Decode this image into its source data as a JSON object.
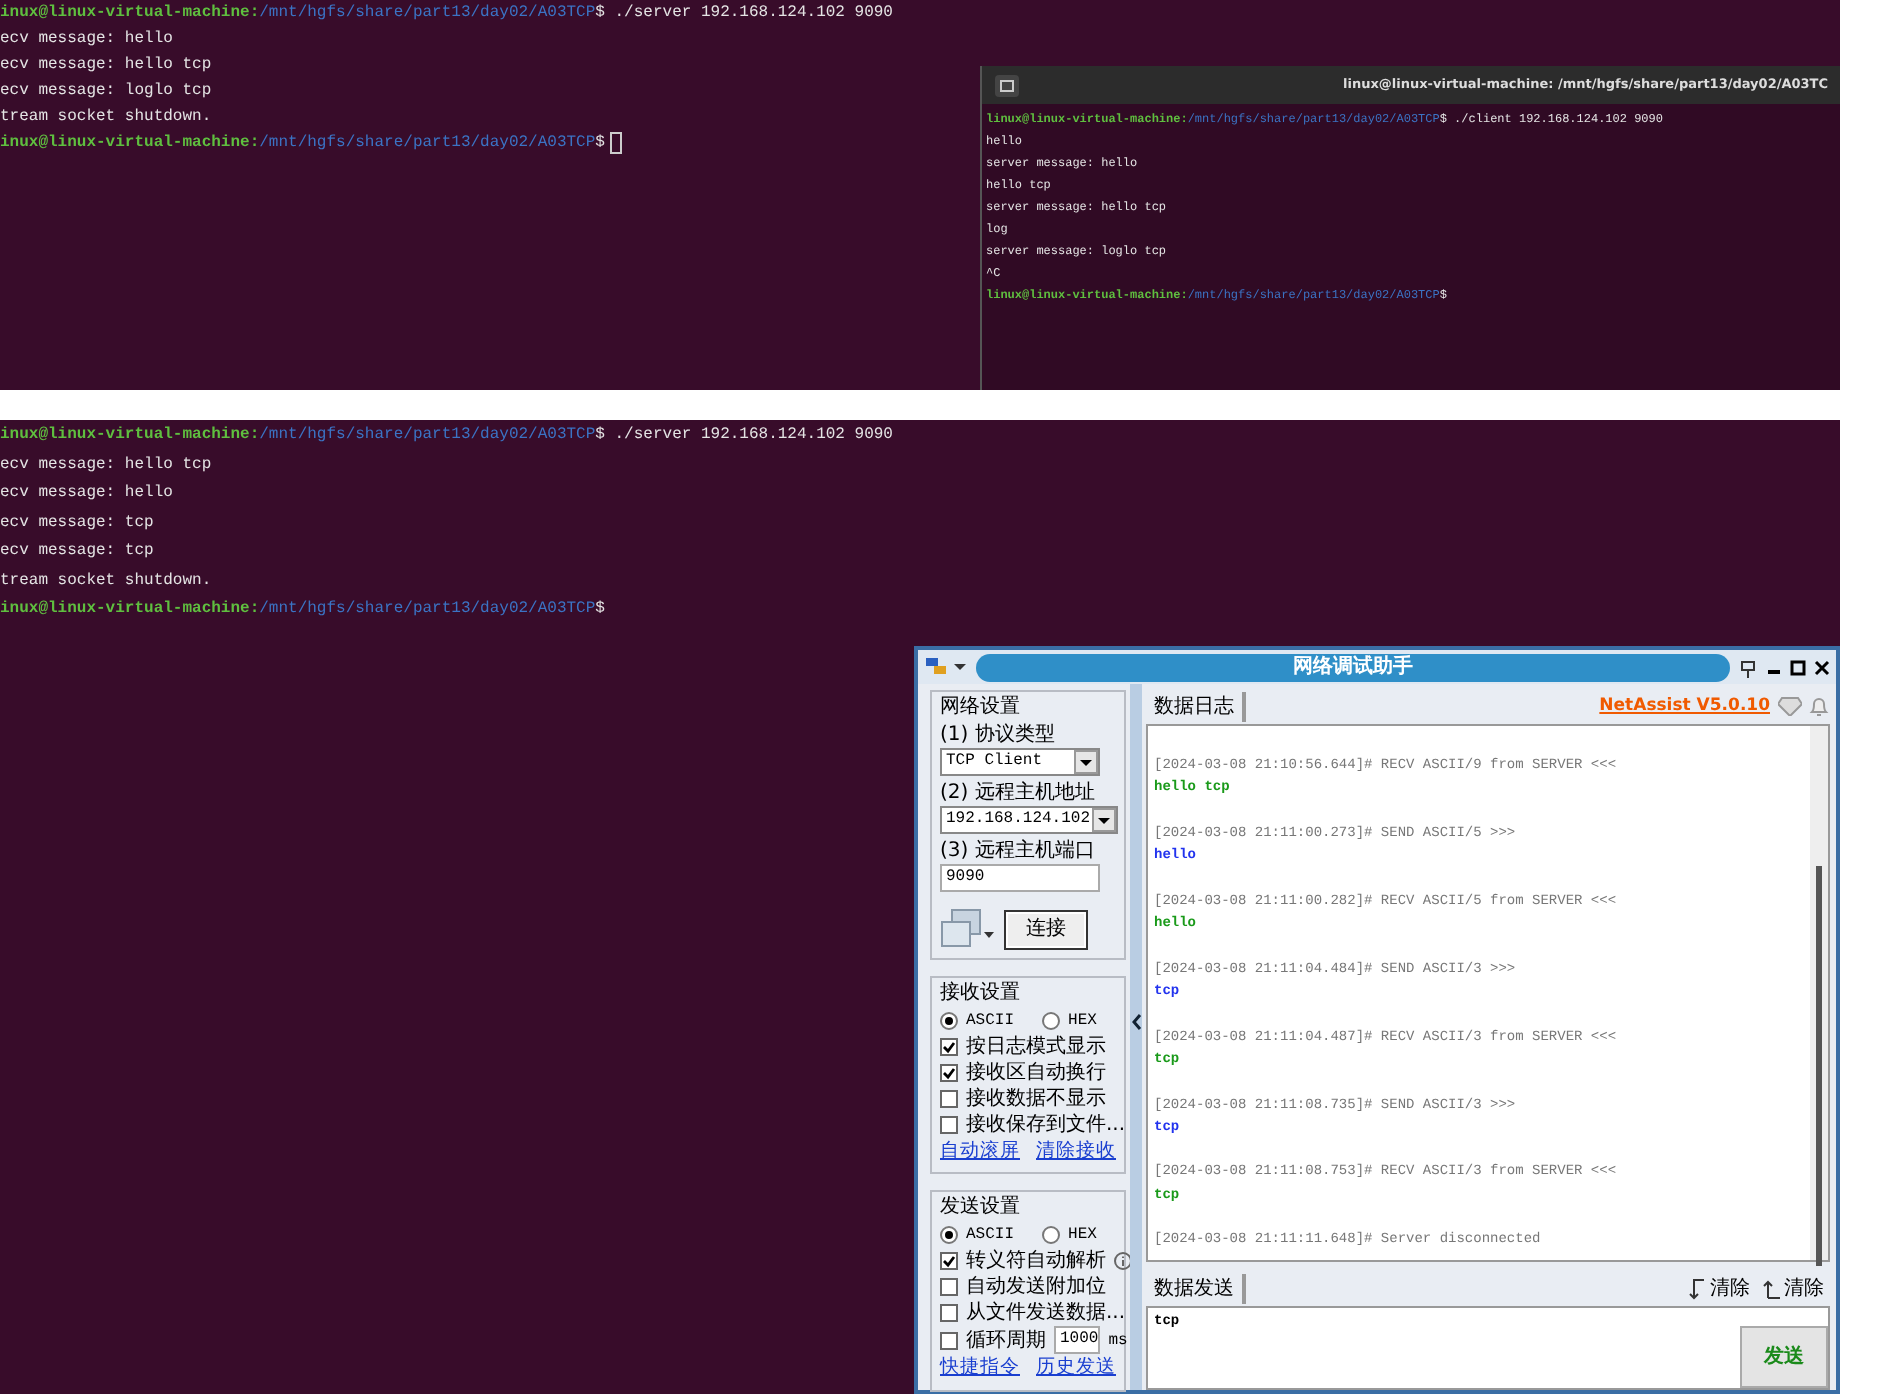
{
  "server_terminal_top": {
    "lines": [
      {
        "kind": "prompt",
        "user": "inux@linux-virtual-machine:",
        "path": "/mnt/hgfs/share/part13/day02/A03TCP",
        "command": "$ ./server 192.168.124.102 9090",
        "cursor": false
      },
      {
        "kind": "output",
        "text": "ecv message: hello"
      },
      {
        "kind": "output",
        "text": "ecv message: hello tcp"
      },
      {
        "kind": "output",
        "text": "ecv message: loglo tcp"
      },
      {
        "kind": "output",
        "text": "tream socket shutdown."
      },
      {
        "kind": "prompt",
        "user": "inux@linux-virtual-machine:",
        "path": "/mnt/hgfs/share/part13/day02/A03TCP",
        "command": "$",
        "cursor": true
      }
    ]
  },
  "client_terminal": {
    "title": "linux@linux-virtual-machine: /mnt/hgfs/share/part13/day02/A03TC",
    "lines": [
      {
        "kind": "prompt",
        "user": "linux@linux-virtual-machine:",
        "path": "/mnt/hgfs/share/part13/day02/A03TCP",
        "command": "$ ./client 192.168.124.102 9090",
        "cursor": false
      },
      {
        "kind": "output",
        "text": "hello"
      },
      {
        "kind": "output",
        "text": "server message: hello"
      },
      {
        "kind": "output",
        "text": "hello tcp"
      },
      {
        "kind": "output",
        "text": "server message: hello tcp"
      },
      {
        "kind": "output",
        "text": "log"
      },
      {
        "kind": "output",
        "text": "server message: loglo tcp"
      },
      {
        "kind": "output",
        "text": "^C"
      },
      {
        "kind": "prompt",
        "user": "linux@linux-virtual-machine:",
        "path": "/mnt/hgfs/share/part13/day02/A03TCP",
        "command": "$",
        "cursor": false
      }
    ]
  },
  "server_terminal_bottom": {
    "lines": [
      {
        "kind": "prompt",
        "user": "inux@linux-virtual-machine:",
        "path": "/mnt/hgfs/share/part13/day02/A03TCP",
        "command": "$ ./server 192.168.124.102 9090",
        "cursor": false
      },
      {
        "kind": "output",
        "text": "ecv message: hello tcp"
      },
      {
        "kind": "output",
        "text": "ecv message: hello"
      },
      {
        "kind": "output",
        "text": "ecv message: tcp"
      },
      {
        "kind": "output",
        "text": "ecv message: tcp"
      },
      {
        "kind": "output",
        "text": "tream socket shutdown."
      },
      {
        "kind": "prompt",
        "user": "inux@linux-virtual-machine:",
        "path": "/mnt/hgfs/share/part13/day02/A03TCP",
        "command": "$",
        "cursor": false
      }
    ]
  },
  "netassist": {
    "title": "网络调试助手",
    "brand": "NetAssist V5.0.10",
    "network_settings": {
      "legend": "网络设置",
      "protocol_label": "(1) 协议类型",
      "protocol": "TCP Client",
      "host_label": "(2) 远程主机地址",
      "host": "192.168.124.102",
      "port_label": "(3) 远程主机端口",
      "port": "9090",
      "connect_button": "连接"
    },
    "receive_settings": {
      "legend": "接收设置",
      "encodings": [
        {
          "label": "ASCII",
          "selected": true
        },
        {
          "label": "HEX",
          "selected": false
        }
      ],
      "options": [
        {
          "kind": "check",
          "label": "按日志模式显示",
          "checked": true
        },
        {
          "kind": "check",
          "label": "接收区自动换行",
          "checked": true
        },
        {
          "kind": "check",
          "label": "接收数据不显示",
          "checked": false
        },
        {
          "kind": "check",
          "label": "接收保存到文件...",
          "checked": false
        }
      ],
      "links": [
        "自动滚屏",
        "清除接收"
      ]
    },
    "send_settings": {
      "legend": "发送设置",
      "encodings": [
        {
          "label": "ASCII",
          "selected": true
        },
        {
          "label": "HEX",
          "selected": false
        }
      ],
      "options": [
        {
          "kind": "check-info",
          "label": "转义符自动解析",
          "checked": true
        },
        {
          "kind": "check",
          "label": "自动发送附加位",
          "checked": false
        },
        {
          "kind": "check",
          "label": "从文件发送数据...",
          "checked": false
        },
        {
          "kind": "check-interval",
          "label": "循环周期",
          "checked": false,
          "value": "1000",
          "unit": "ms"
        }
      ],
      "links": [
        "快捷指令",
        "历史发送"
      ]
    },
    "log": {
      "tab": "数据日志",
      "entries": [
        {
          "kind": "recv",
          "header": "[2024-03-08 21:10:56.644]# RECV ASCII/9 from SERVER <<<",
          "body": "hello tcp"
        },
        {
          "kind": "send",
          "header": "[2024-03-08 21:11:00.273]# SEND ASCII/5 >>>",
          "body": "hello"
        },
        {
          "kind": "recv",
          "header": "[2024-03-08 21:11:00.282]# RECV ASCII/5 from SERVER <<<",
          "body": "hello"
        },
        {
          "kind": "send",
          "header": "[2024-03-08 21:11:04.484]# SEND ASCII/3 >>>",
          "body": "tcp"
        },
        {
          "kind": "recv",
          "header": "[2024-03-08 21:11:04.487]# RECV ASCII/3 from SERVER <<<",
          "body": "tcp"
        },
        {
          "kind": "send",
          "header": "[2024-03-08 21:11:08.735]# SEND ASCII/3 >>>",
          "body": "tcp"
        },
        {
          "kind": "recv",
          "header": "[2024-03-08 21:11:08.753]# RECV ASCII/3 from SERVER <<<",
          "body": "tcp"
        },
        {
          "kind": "status",
          "header": "[2024-03-08 21:11:11.648]# Server disconnected"
        }
      ]
    },
    "send_area": {
      "tab": "数据发送",
      "clear_buttons": [
        "清除",
        "清除"
      ],
      "text": "tcp",
      "send_button": "发送"
    }
  }
}
